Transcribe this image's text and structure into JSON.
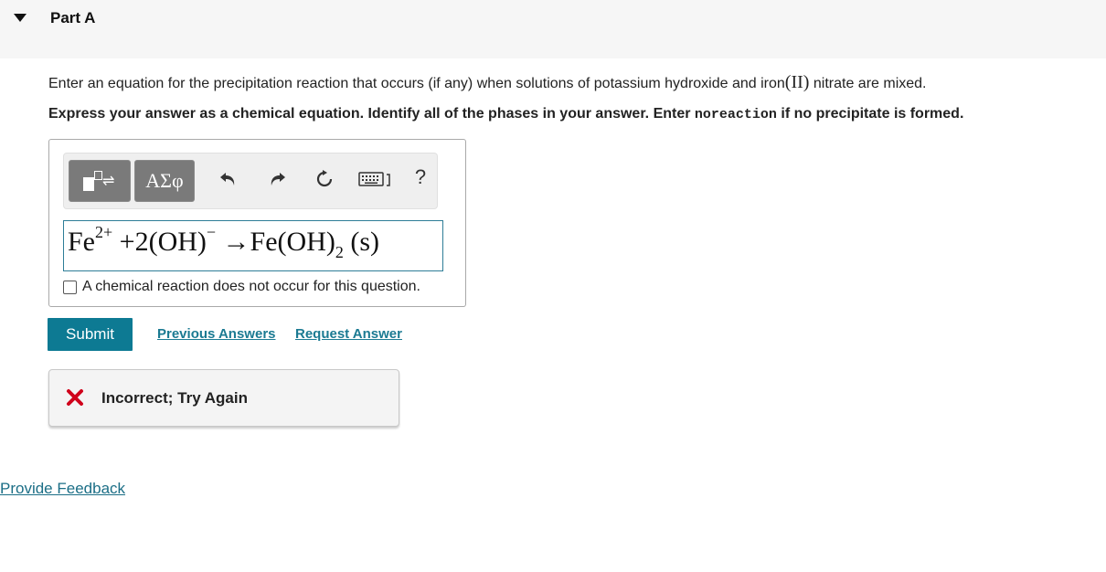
{
  "part": {
    "title": "Part A"
  },
  "question": {
    "text_before": "Enter an equation for the precipitation reaction that occurs (if any) when solutions of potassium hydroxide and iron",
    "roman": "(II)",
    "text_after": " nitrate are mixed."
  },
  "instruction": {
    "before": "Express your answer as a chemical equation. Identify all of the phases in your answer. Enter ",
    "code": "noreaction",
    "after": " if no precipitate is formed."
  },
  "toolbar": {
    "symbols_label": "ΑΣφ",
    "help_label": "?",
    "icons": [
      "templates-icon",
      "undo-icon",
      "redo-icon",
      "reset-icon",
      "keyboard-icon",
      "help-icon"
    ]
  },
  "equation": {
    "t1": "Fe",
    "s1": "2+",
    "t2": " +2(OH)",
    "s2": "−",
    "t3": " →Fe(OH)",
    "sub": "2",
    "t4": " (s)"
  },
  "no_reaction_label": "A chemical reaction does not occur for this question.",
  "actions": {
    "submit": "Submit",
    "previous_answers": "Previous Answers",
    "request_answer": "Request Answer"
  },
  "feedback": {
    "text": "Incorrect; Try Again",
    "color": "#d0021b"
  },
  "footer": {
    "provide_feedback": "Provide Feedback"
  },
  "colors": {
    "accent": "#0d7a93",
    "link": "#1b7a92"
  }
}
